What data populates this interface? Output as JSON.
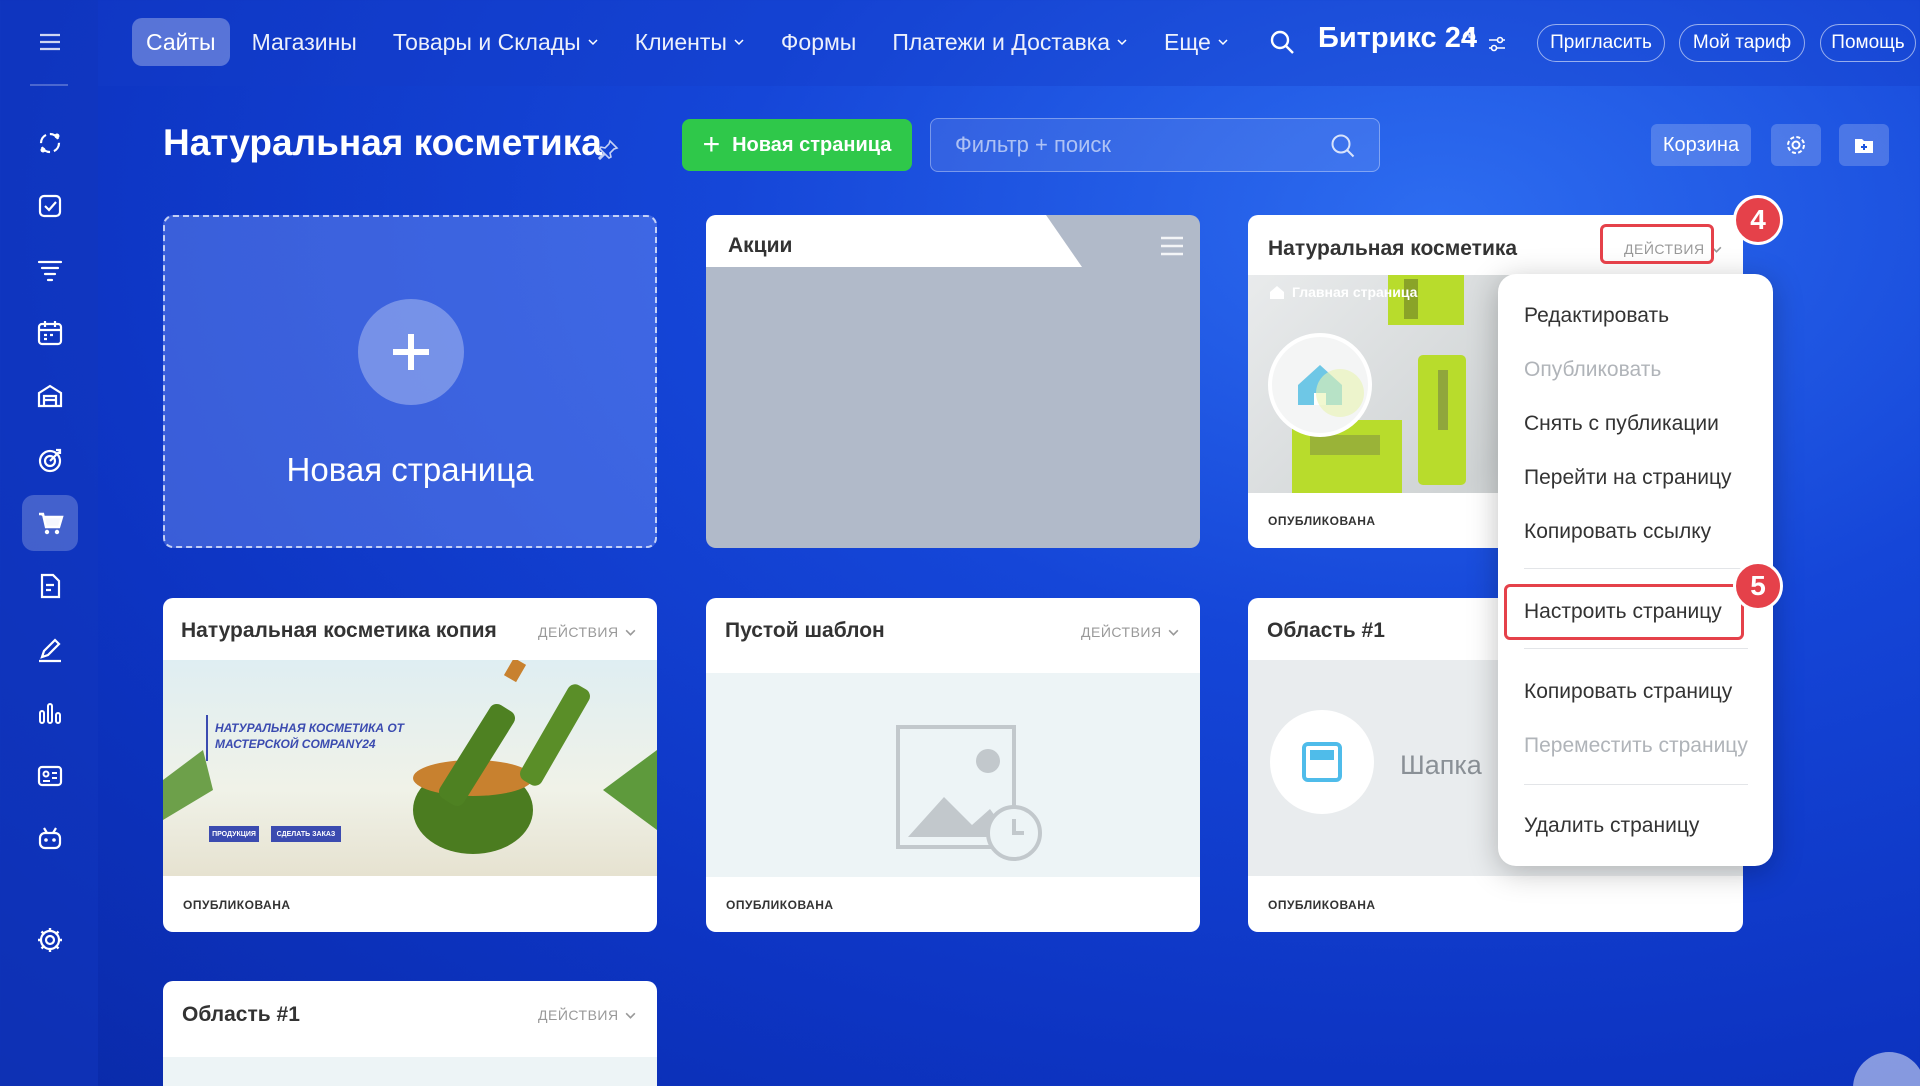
{
  "nav": {
    "items": [
      {
        "label": "Сайты",
        "active": true,
        "dropdown": false
      },
      {
        "label": "Магазины",
        "active": false,
        "dropdown": false
      },
      {
        "label": "Товары и Склады",
        "active": false,
        "dropdown": true
      },
      {
        "label": "Клиенты",
        "active": false,
        "dropdown": true
      },
      {
        "label": "Формы",
        "active": false,
        "dropdown": false
      },
      {
        "label": "Платежи и Доставка",
        "active": false,
        "dropdown": true
      },
      {
        "label": "Еще",
        "active": false,
        "dropdown": true
      }
    ]
  },
  "header": {
    "brand": "Битрикс 24",
    "invite_label": "Пригласить",
    "tariff_label": "Мой тариф",
    "help_label": "Помощь"
  },
  "sidebar": {
    "icons": [
      "menu-icon",
      "activity-stream-icon",
      "tasks-icon",
      "crm-filter-icon",
      "calendar-icon",
      "inventory-icon",
      "target-icon",
      "cart-icon",
      "documents-icon",
      "signature-icon",
      "analytics-icon",
      "contact-card-icon",
      "robot-icon",
      "settings-icon"
    ],
    "active": "cart-icon"
  },
  "toolbar": {
    "page_title": "Натуральная косметика",
    "new_page_label": "Новая страница",
    "search_placeholder": "Фильтр + поиск",
    "trash_label": "Корзина"
  },
  "cards": {
    "new_page_label": "Новая страница",
    "folder_title": "Акции",
    "actions_label": "ДЕЙСТВИЯ",
    "status_published": "ОПУБЛИКОВАНА",
    "main": {
      "title": "Натуральная косметика",
      "preview_label": "Главная страница"
    },
    "copy": {
      "title": "Натуральная косметика копия",
      "banner": "НАТУРАЛЬНАЯ КОСМЕТИКА ОТ МАСТЕРСКОЙ COMPANY24",
      "btn1": "ПРОДУКЦИЯ",
      "btn2": "СДЕЛАТЬ ЗАКАЗ"
    },
    "empty": {
      "title": "Пустой шаблон"
    },
    "area1": {
      "title": "Область #1",
      "header_label": "Шапка"
    },
    "area2": {
      "title": "Область #1"
    }
  },
  "dropdown": {
    "items": [
      {
        "label": "Редактировать",
        "disabled": false
      },
      {
        "label": "Опубликовать",
        "disabled": true
      },
      {
        "label": "Снять с публикации",
        "disabled": false
      },
      {
        "label": "Перейти на страницу",
        "disabled": false
      },
      {
        "label": "Копировать ссылку",
        "disabled": false
      },
      {
        "label": "Настроить страницу",
        "disabled": false
      },
      {
        "label": "Копировать страницу",
        "disabled": false
      },
      {
        "label": "Переместить страницу",
        "disabled": true
      },
      {
        "label": "Удалить страницу",
        "disabled": false
      }
    ]
  },
  "callouts": {
    "step4": "4",
    "step5": "5"
  },
  "colors": {
    "accent_green": "#2fc84a",
    "callout_red": "#e5414a",
    "background_blue": "#1546d8"
  }
}
